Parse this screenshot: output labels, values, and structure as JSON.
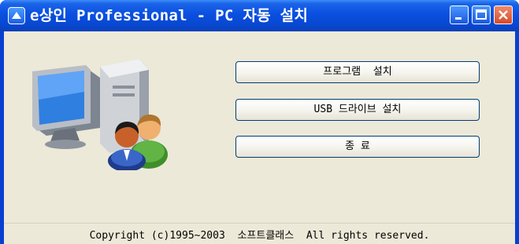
{
  "window": {
    "title": "e상인 Professional - PC 자동 설치",
    "system_icon": "up-arrow-icon",
    "caption_buttons": [
      "minimize-icon",
      "maximize-icon",
      "close-icon"
    ],
    "colors": {
      "titlebar": "#0848d0",
      "client_background": "#ece9d8",
      "close_button": "#d84a28"
    }
  },
  "illustration": {
    "icons": [
      "computer-icon",
      "users-icon"
    ]
  },
  "actions": {
    "install_program": "프로그램  설치",
    "install_usb_driver": "USB 드라이브 설치",
    "exit": "종 료"
  },
  "footer": {
    "copyright_prefix": "Copyright (c)1995~2003",
    "company": "소프트클래스",
    "rights": "All rights reserved."
  }
}
